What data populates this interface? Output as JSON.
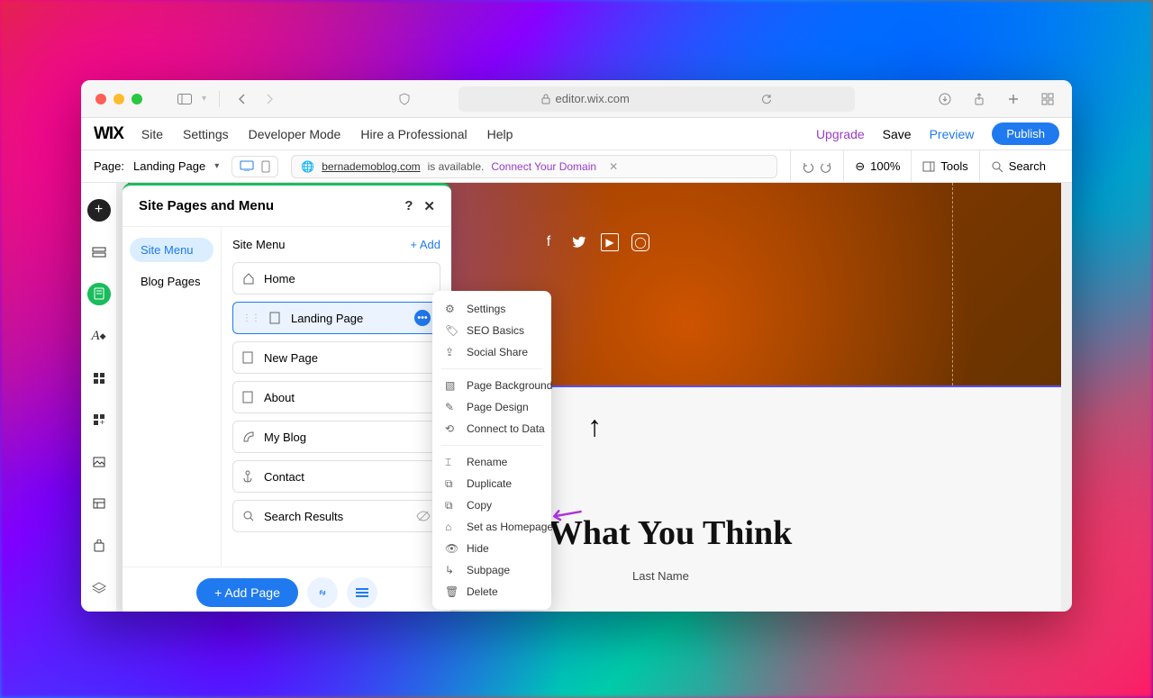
{
  "browser": {
    "url": "editor.wix.com"
  },
  "wix_menu": {
    "logo": "WIX",
    "items": [
      "Site",
      "Settings",
      "Developer Mode",
      "Hire a Professional",
      "Help"
    ],
    "upgrade": "Upgrade",
    "save": "Save",
    "preview": "Preview",
    "publish": "Publish"
  },
  "toolbar": {
    "page_label": "Page:",
    "page_name": "Landing Page",
    "domain": "bernademoblog.com",
    "available": "is available.",
    "connect": "Connect Your Domain",
    "zoom": "100%",
    "tools": "Tools",
    "search": "Search"
  },
  "panel": {
    "title": "Site Pages and Menu",
    "tabs": {
      "site_menu": "Site Menu",
      "blog_pages": "Blog Pages"
    },
    "list_heading": "Site Menu",
    "add": "+  Add",
    "pages": [
      {
        "icon": "home",
        "label": "Home"
      },
      {
        "icon": "page",
        "label": "Landing Page",
        "active": true
      },
      {
        "icon": "page",
        "label": "New Page"
      },
      {
        "icon": "page",
        "label": "About"
      },
      {
        "icon": "blog",
        "label": "My Blog"
      },
      {
        "icon": "anchor",
        "label": "Contact"
      },
      {
        "icon": "search",
        "label": "Search Results",
        "hidden": true
      }
    ],
    "add_page": "+ Add Page"
  },
  "context_menu": {
    "group1": [
      "Settings",
      "SEO Basics",
      "Social Share"
    ],
    "group2": [
      "Page Background",
      "Page Design",
      "Connect to Data"
    ],
    "group3": [
      "Rename",
      "Duplicate",
      "Copy",
      "Set as Homepage",
      "Hide",
      "Subpage",
      "Delete"
    ]
  },
  "canvas": {
    "headline": "Me Know What You Think",
    "last_name": "Last Name"
  }
}
